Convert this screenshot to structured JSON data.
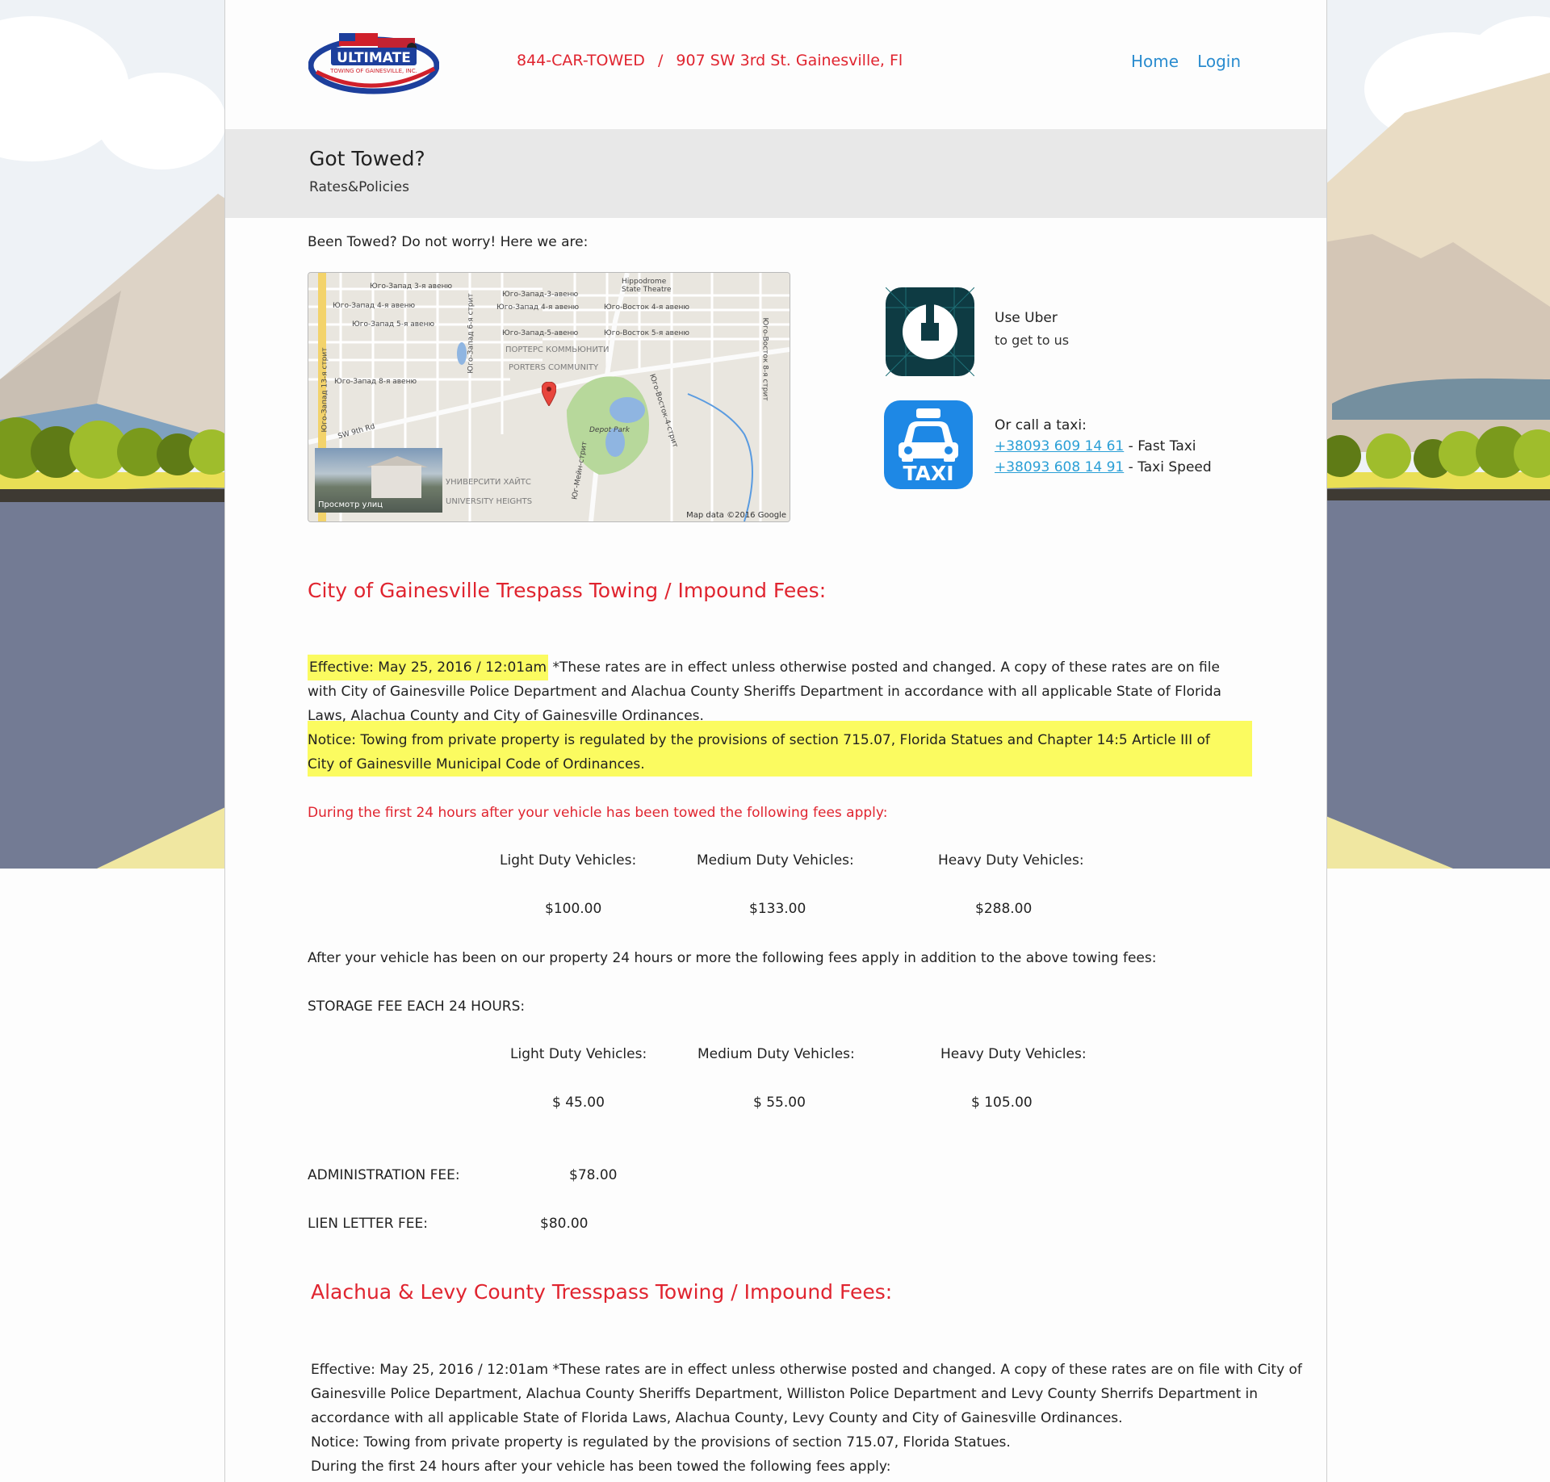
{
  "header": {
    "logo_alt": "ULTIMATE TOWING OF GAINESVILLE, INC.",
    "phone": "844-CAR-TOWED",
    "separator": "/",
    "address": "907 SW 3rd St.  Gainesville, Fl",
    "nav": [
      {
        "label": "Home"
      },
      {
        "label": "Login"
      }
    ]
  },
  "banner": {
    "title": "Got Towed?",
    "subtitle": "Rates&Policies"
  },
  "intro": "Been Towed? Do not worry! Here we are:",
  "map": {
    "labels": [
      "Юго-Запад 3-я авеню",
      "Юго-Запад 4-я авеню",
      "Юго-Запад 5-я авеню",
      "Юго-Запад 8-я авеню",
      "SW 9th Rd",
      "Юго-Запад 6-я стрит",
      "Юго-Запад 13-я стрит",
      "Юго-Запад-3-авеню",
      "Юго-Запад 4-я авеню",
      "Юго-Запад-5-авеню",
      "Юго-Восток 4-я авеню",
      "Юго-Восток 5-я авеню",
      "Hippodrome State Theatre",
      "ПОРТЕРС КОММЬЮНИТИ",
      "PORTERS COMMUNITY",
      "Depot Park",
      "Юг-Мейн-стрит",
      "Юго-Восток-4-стрит",
      "Юго-Восток 8-я стрит",
      "УНИВЕРСИТИ ХАЙТС",
      "UNIVERSITY HEIGHTS"
    ],
    "streetview_label": "Просмотр улиц",
    "credit": "Map data ©2016 Google"
  },
  "uber": {
    "title": "Use Uber",
    "subtitle": "to get to us"
  },
  "taxi": {
    "icon_text": "TAXI",
    "title": "Or call a taxi:",
    "phones": [
      {
        "number": "+38093 609 14 61",
        "name": " - Fast Taxi"
      },
      {
        "number": "+38093 608 14 91",
        "name": " - Taxi Speed"
      }
    ]
  },
  "gainesville": {
    "heading": "City of Gainesville Trespass Towing / Impound Fees:",
    "effective_label": "Effective:  May 25, 2016 / 12:01am",
    "effective_text": " *These rates are in effect unless otherwise posted and changed.  A copy of these rates are on file",
    "line2": "with City of Gainesville Police Department and Alachua County Sheriffs Department in accordance with all applicable State of Florida",
    "line3": "Laws, Alachua County and City of Gainesville Ordinances.",
    "notice1": "Notice:    Towing from private property is regulated by the provisions of section 715.07, Florida Statues and Chapter 14:5 Article III of",
    "notice2": "City of Gainesville Municipal Code of Ordinances.",
    "first24": "During the first 24 hours after your vehicle has been towed the following fees apply:",
    "tow_headers": [
      "Light Duty Vehicles:",
      "Medium Duty Vehicles:",
      "Heavy Duty Vehicles:"
    ],
    "tow_values": [
      "$100.00",
      "$133.00",
      "$288.00"
    ],
    "after24": "After your vehicle has been on our property 24 hours or more the following fees apply in addition to the above towing fees:",
    "storage_label": "STORAGE FEE EACH 24 HOURS:",
    "storage_headers": [
      "Light Duty Vehicles:",
      "Medium Duty Vehicles:",
      "Heavy Duty Vehicles:"
    ],
    "storage_values": [
      "$  45.00",
      "$  55.00",
      "$  105.00"
    ],
    "admin_label": "ADMINISTRATION FEE:",
    "admin_value": "$78.00",
    "lien_label": "LIEN LETTER FEE:",
    "lien_value": "$80.00"
  },
  "alachua": {
    "heading": "Alachua & Levy County Tresspass Towing / Impound Fees:",
    "line1": "Effective:  May 25, 2016 / 12:01am *These rates are in effect unless otherwise posted and changed.  A copy of these rates are on file with City of",
    "line2": "Gainesville Police Department, Alachua County Sheriffs Department, Williston Police Department and Levy County Sherrifs Department in",
    "line3": "accordance with all applicable State of Florida Laws, Alachua County, Levy County and City of Gainesville Ordinances.",
    "line4": "Notice:    Towing from private property is regulated by the provisions of section 715.07, Florida Statues.",
    "line5": "During the first 24 hours after your vehicle has been towed the following fees apply:"
  }
}
